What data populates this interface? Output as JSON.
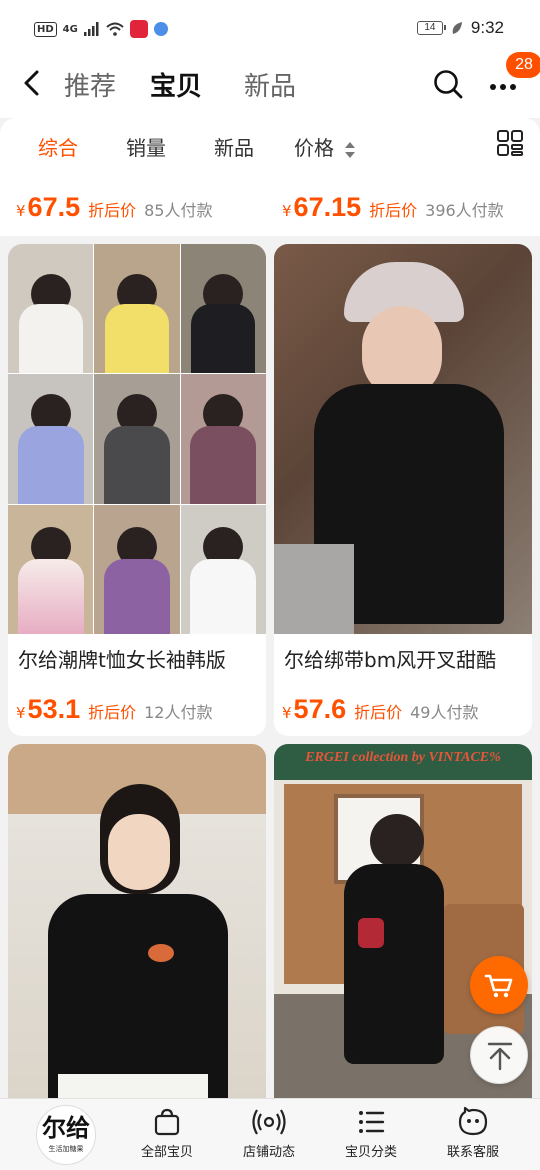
{
  "status_bar": {
    "hd": "HD",
    "network": "4G",
    "battery": "14",
    "time": "9:32"
  },
  "nav": {
    "tabs": [
      "推荐",
      "宝贝",
      "新品"
    ],
    "active_tab": "宝贝",
    "cart_badge": "28"
  },
  "filters": {
    "items": [
      "综合",
      "销量",
      "新品",
      "价格"
    ],
    "active": "综合"
  },
  "currency": "¥",
  "products": [
    {
      "price": "67.5",
      "discount_label": "折后价",
      "paid": "85人付款"
    },
    {
      "price": "67.15",
      "discount_label": "折后价",
      "paid": "396人付款"
    },
    {
      "title": "尔给潮牌t恤女长袖韩版",
      "price": "53.1",
      "discount_label": "折后价",
      "paid": "12人付款"
    },
    {
      "title": "尔给绑带bm风开叉甜酷",
      "price": "57.6",
      "discount_label": "折后价",
      "paid": "49人付款"
    }
  ],
  "banner_text": "ERGEI collection by VINTACE%",
  "bottom_bar": {
    "logo_text": "尔给",
    "logo_sub": "生活加糖果",
    "items": [
      "全部宝贝",
      "店铺动态",
      "宝贝分类",
      "联系客服"
    ]
  },
  "colors": {
    "accent": "#ff5000",
    "cart_button": "#ff6a00"
  }
}
